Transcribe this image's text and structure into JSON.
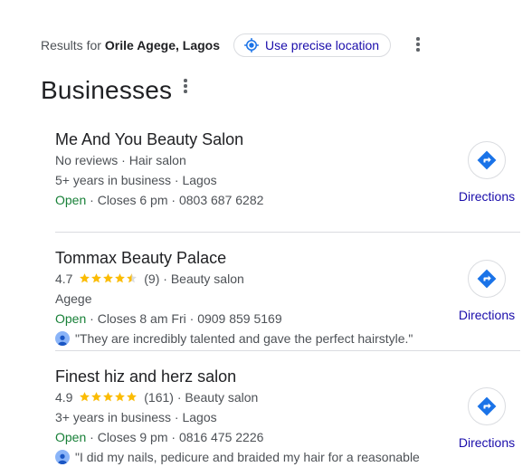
{
  "results": {
    "prefix": "Results for",
    "location": "Orile Agege, Lagos",
    "precise_location_label": "Use precise location"
  },
  "section": {
    "title": "Businesses"
  },
  "colors": {
    "link": "#1a0dab",
    "open": "#188038",
    "star": "#fbbc04",
    "directions_icon": "#1a73e8"
  },
  "businesses": [
    {
      "name": "Me And You Beauty Salon",
      "reviews_text": "No reviews",
      "category": "Hair salon",
      "years": "5+ years in business",
      "area": "Lagos",
      "status": "Open",
      "hours": "Closes 6 pm",
      "phone": "0803 687 6282",
      "directions_label": "Directions"
    },
    {
      "name": "Tommax Beauty Palace",
      "rating": "4.7",
      "stars": 4.7,
      "count": "(9)",
      "category": "Beauty salon",
      "area": "Agege",
      "status": "Open",
      "hours": "Closes 8 am Fri",
      "phone": "0909 859 5169",
      "review": "\"They are incredibly talented and gave the perfect hairstyle.\"",
      "directions_label": "Directions"
    },
    {
      "name": "Finest hiz and herz salon",
      "rating": "4.9",
      "stars": 4.9,
      "count": "(161)",
      "category": "Beauty salon",
      "years": "3+ years in business",
      "area": "Lagos",
      "status": "Open",
      "hours": "Closes 9 pm",
      "phone": "0816 475 2226",
      "review": "\"I did my nails, pedicure and braided my hair for a reasonable",
      "directions_label": "Directions"
    }
  ],
  "separator": "·"
}
